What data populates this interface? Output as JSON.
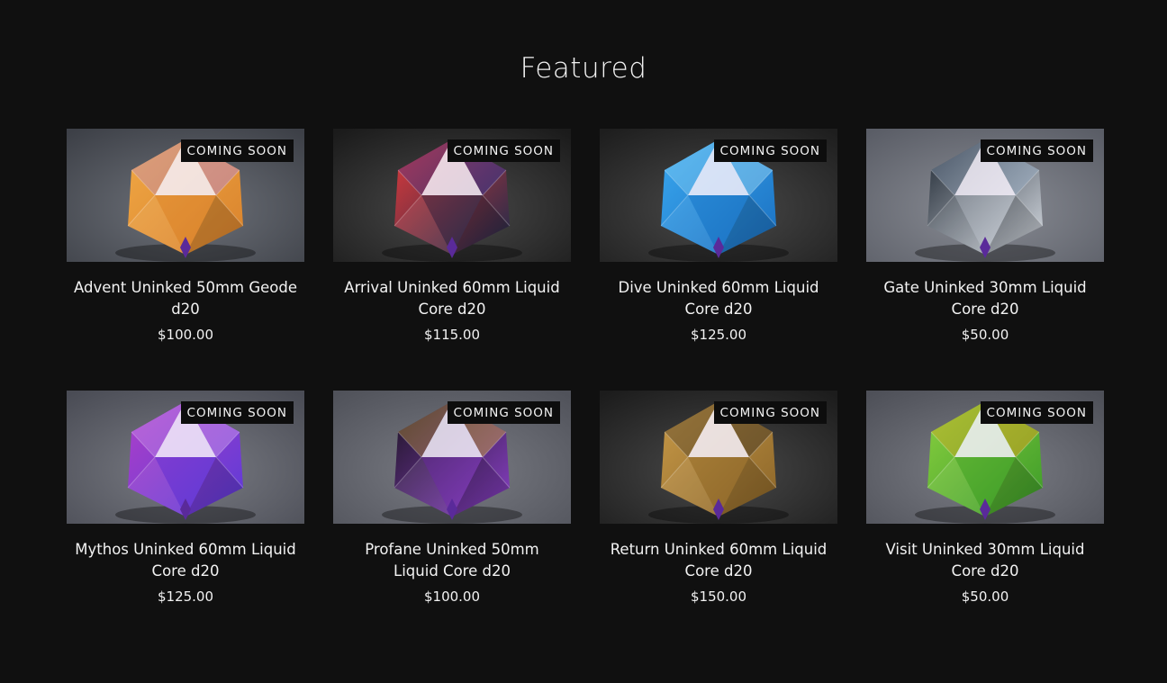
{
  "section": {
    "title": "Featured"
  },
  "products": [
    {
      "title": "Advent Uninked 50mm Geode d20",
      "price": "$100.00",
      "badge": "COMING SOON",
      "bg": [
        "#6e727a",
        "#3d4047"
      ],
      "die": [
        "#f0a845",
        "#d9822c"
      ],
      "accent": "#b58be0"
    },
    {
      "title": "Arrival Uninked 60mm Liquid Core d20",
      "price": "$115.00",
      "badge": "COMING SOON",
      "bg": [
        "#4a4a4a",
        "#1b1b1b"
      ],
      "die": [
        "#e23a3a",
        "#1a2a4a"
      ],
      "accent": "#3a3aa0"
    },
    {
      "title": "Dive Uninked 60mm Liquid Core d20",
      "price": "$125.00",
      "badge": "COMING SOON",
      "bg": [
        "#4a4a4a",
        "#1e1e1e"
      ],
      "die": [
        "#3aa8f0",
        "#1a6fc0"
      ],
      "accent": "#9fdcf7"
    },
    {
      "title": "Gate Uninked 30mm Liquid Core d20",
      "price": "$50.00",
      "badge": "COMING SOON",
      "bg": [
        "#8a8d95",
        "#5a5d66"
      ],
      "die": [
        "#1c2530",
        "#d8dde4"
      ],
      "accent": "#9ab0c8"
    },
    {
      "title": "Mythos Uninked 60mm Liquid Core d20",
      "price": "$125.00",
      "badge": "COMING SOON",
      "bg": [
        "#7a7c84",
        "#4a4c55"
      ],
      "die": [
        "#b040c8",
        "#5a3ad8"
      ],
      "accent": "#d0a0f0"
    },
    {
      "title": "Profane Uninked 50mm Liquid Core d20",
      "price": "$100.00",
      "badge": "COMING SOON",
      "bg": [
        "#7a7c84",
        "#50525a"
      ],
      "die": [
        "#1c1420",
        "#8a40c8"
      ],
      "accent": "#d8b040"
    },
    {
      "title": "Return Uninked 60mm Liquid Core d20",
      "price": "$150.00",
      "badge": "COMING SOON",
      "bg": [
        "#4a4a4a",
        "#1c1c1c"
      ],
      "die": [
        "#c89a48",
        "#8a6428"
      ],
      "accent": "#3a3024"
    },
    {
      "title": "Visit Uninked 30mm Liquid Core d20",
      "price": "$50.00",
      "badge": "COMING SOON",
      "bg": [
        "#7c7e86",
        "#4e5058"
      ],
      "die": [
        "#8ad040",
        "#3a9a28"
      ],
      "accent": "#f0a020"
    }
  ]
}
